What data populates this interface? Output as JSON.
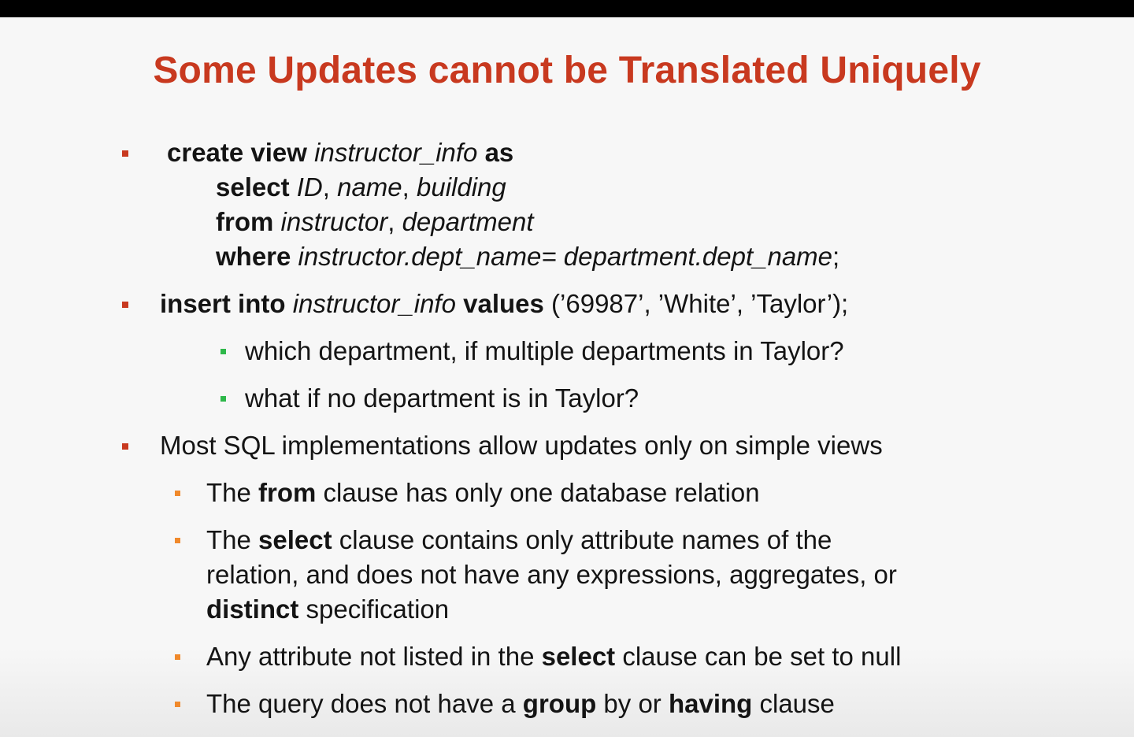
{
  "slide": {
    "title": "Some Updates cannot be Translated Uniquely",
    "bullet1": {
      "l1": {
        "a": "create view",
        "b": "instructor_info",
        "c": "as"
      },
      "l2": {
        "a": "select",
        "b": "ID",
        "c": ", ",
        "d": "name",
        "e": ", ",
        "f": "building"
      },
      "l3": {
        "a": "from",
        "b": "instructor",
        "c": ", ",
        "d": "department"
      },
      "l4": {
        "a": "where",
        "b": "instructor.dept_name=",
        "c": "department.dept_name",
        "d": ";"
      }
    },
    "bullet2": {
      "a": "insert into",
      "b": "instructor_info",
      "c": "values",
      "d": "(’69987’, ’White’, ’Taylor’);",
      "sub1": "which department, if multiple departments in Taylor?",
      "sub2": "what if no department is in Taylor?"
    },
    "bullet3": {
      "text": "Most SQL implementations allow updates only on simple views",
      "s1": {
        "a": "The ",
        "b": "from",
        "c": " clause has only one database relation"
      },
      "s2": {
        "l1a": "The ",
        "l1b": "select",
        "l1c": " clause contains only attribute names of the",
        "l2": "relation, and does not have any expressions, aggregates, or",
        "l3a": "distinct",
        "l3b": " specification"
      },
      "s3": {
        "a": "Any attribute not listed in the ",
        "b": "select",
        "c": " clause can be set to null"
      },
      "s4": {
        "a": "The query does not have a ",
        "b": "group",
        "c": " by or ",
        "d": "having",
        "e": " clause"
      }
    }
  }
}
